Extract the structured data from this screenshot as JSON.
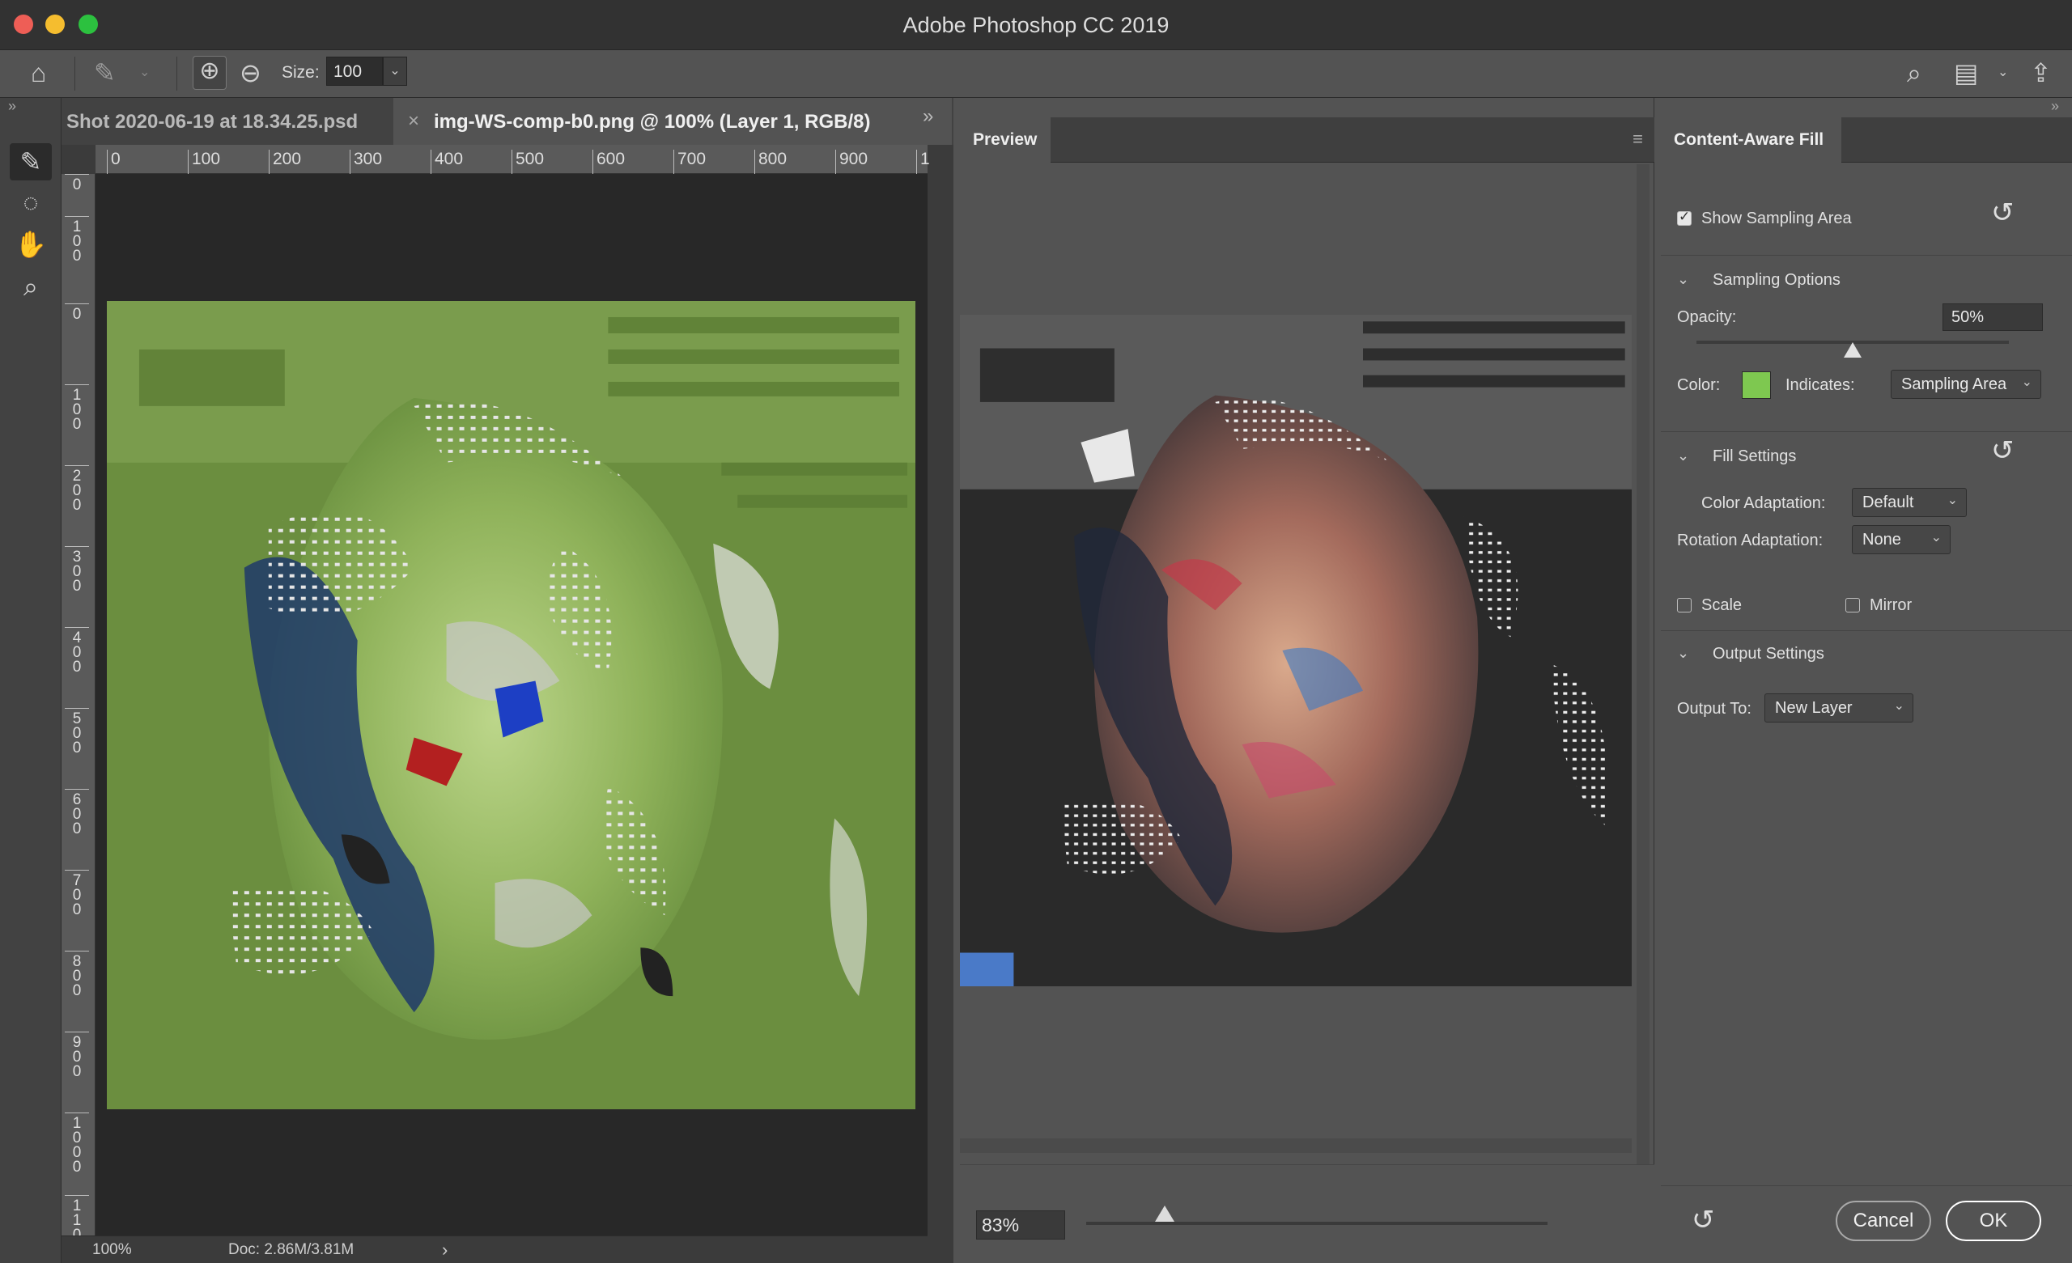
{
  "window": {
    "title": "Adobe Photoshop CC 2019"
  },
  "options": {
    "size_label": "Size:",
    "size_value": "100"
  },
  "tabs": [
    {
      "label": "Shot 2020-06-19 at 18.34.25.psd",
      "active": false
    },
    {
      "label": "img-WS-comp-b0.png @ 100% (Layer 1, RGB/8)",
      "active": true,
      "close": "×"
    }
  ],
  "more_glyph": "»",
  "ruler": {
    "top": [
      "0",
      "100",
      "200",
      "300",
      "400",
      "500",
      "600",
      "700",
      "800",
      "900",
      "1"
    ],
    "left": [
      "0",
      "1\n0\n0",
      "0",
      "1\n0\n0",
      "2\n0\n0",
      "3\n0\n0",
      "4\n0\n0",
      "5\n0\n0",
      "6\n0\n0",
      "7\n0\n0",
      "8\n0\n0",
      "9\n0\n0",
      "1\n0\n0\n0",
      "1\n1\n0"
    ]
  },
  "status": {
    "zoom": "100%",
    "doc": "Doc: 2.86M/3.81M",
    "arrow": "›"
  },
  "preview": {
    "tab": "Preview",
    "zoom": "83%",
    "zoom_fraction": 0.17
  },
  "content_aware_fill": {
    "tab": "Content-Aware Fill",
    "show_sampling_area": {
      "label": "Show Sampling Area",
      "checked": true
    },
    "sampling_options": {
      "header": "Sampling Options",
      "opacity_label": "Opacity:",
      "opacity_value": "50%",
      "opacity_fraction": 0.5,
      "color_label": "Color:",
      "color": "#7ec850",
      "indicates_label": "Indicates:",
      "indicates_value": "Sampling Area"
    },
    "fill_settings": {
      "header": "Fill Settings",
      "color_adaptation_label": "Color Adaptation:",
      "color_adaptation_value": "Default",
      "rotation_adaptation_label": "Rotation Adaptation:",
      "rotation_adaptation_value": "None",
      "scale_label": "Scale",
      "scale_checked": false,
      "mirror_label": "Mirror",
      "mirror_checked": false
    },
    "output_settings": {
      "header": "Output Settings",
      "output_to_label": "Output To:",
      "output_to_value": "New Layer"
    },
    "buttons": {
      "cancel": "Cancel",
      "ok": "OK"
    }
  },
  "icons": {
    "home": "⌂",
    "brush": "✎",
    "add_mode": "⊕",
    "subtract_mode": "⊖",
    "search": "⌕",
    "workspace": "▤",
    "share": "⇪",
    "hand": "✋",
    "lasso": "◌",
    "zoom": "⌕",
    "reset": "↺",
    "menu": "≡",
    "chevron": "⌄"
  }
}
